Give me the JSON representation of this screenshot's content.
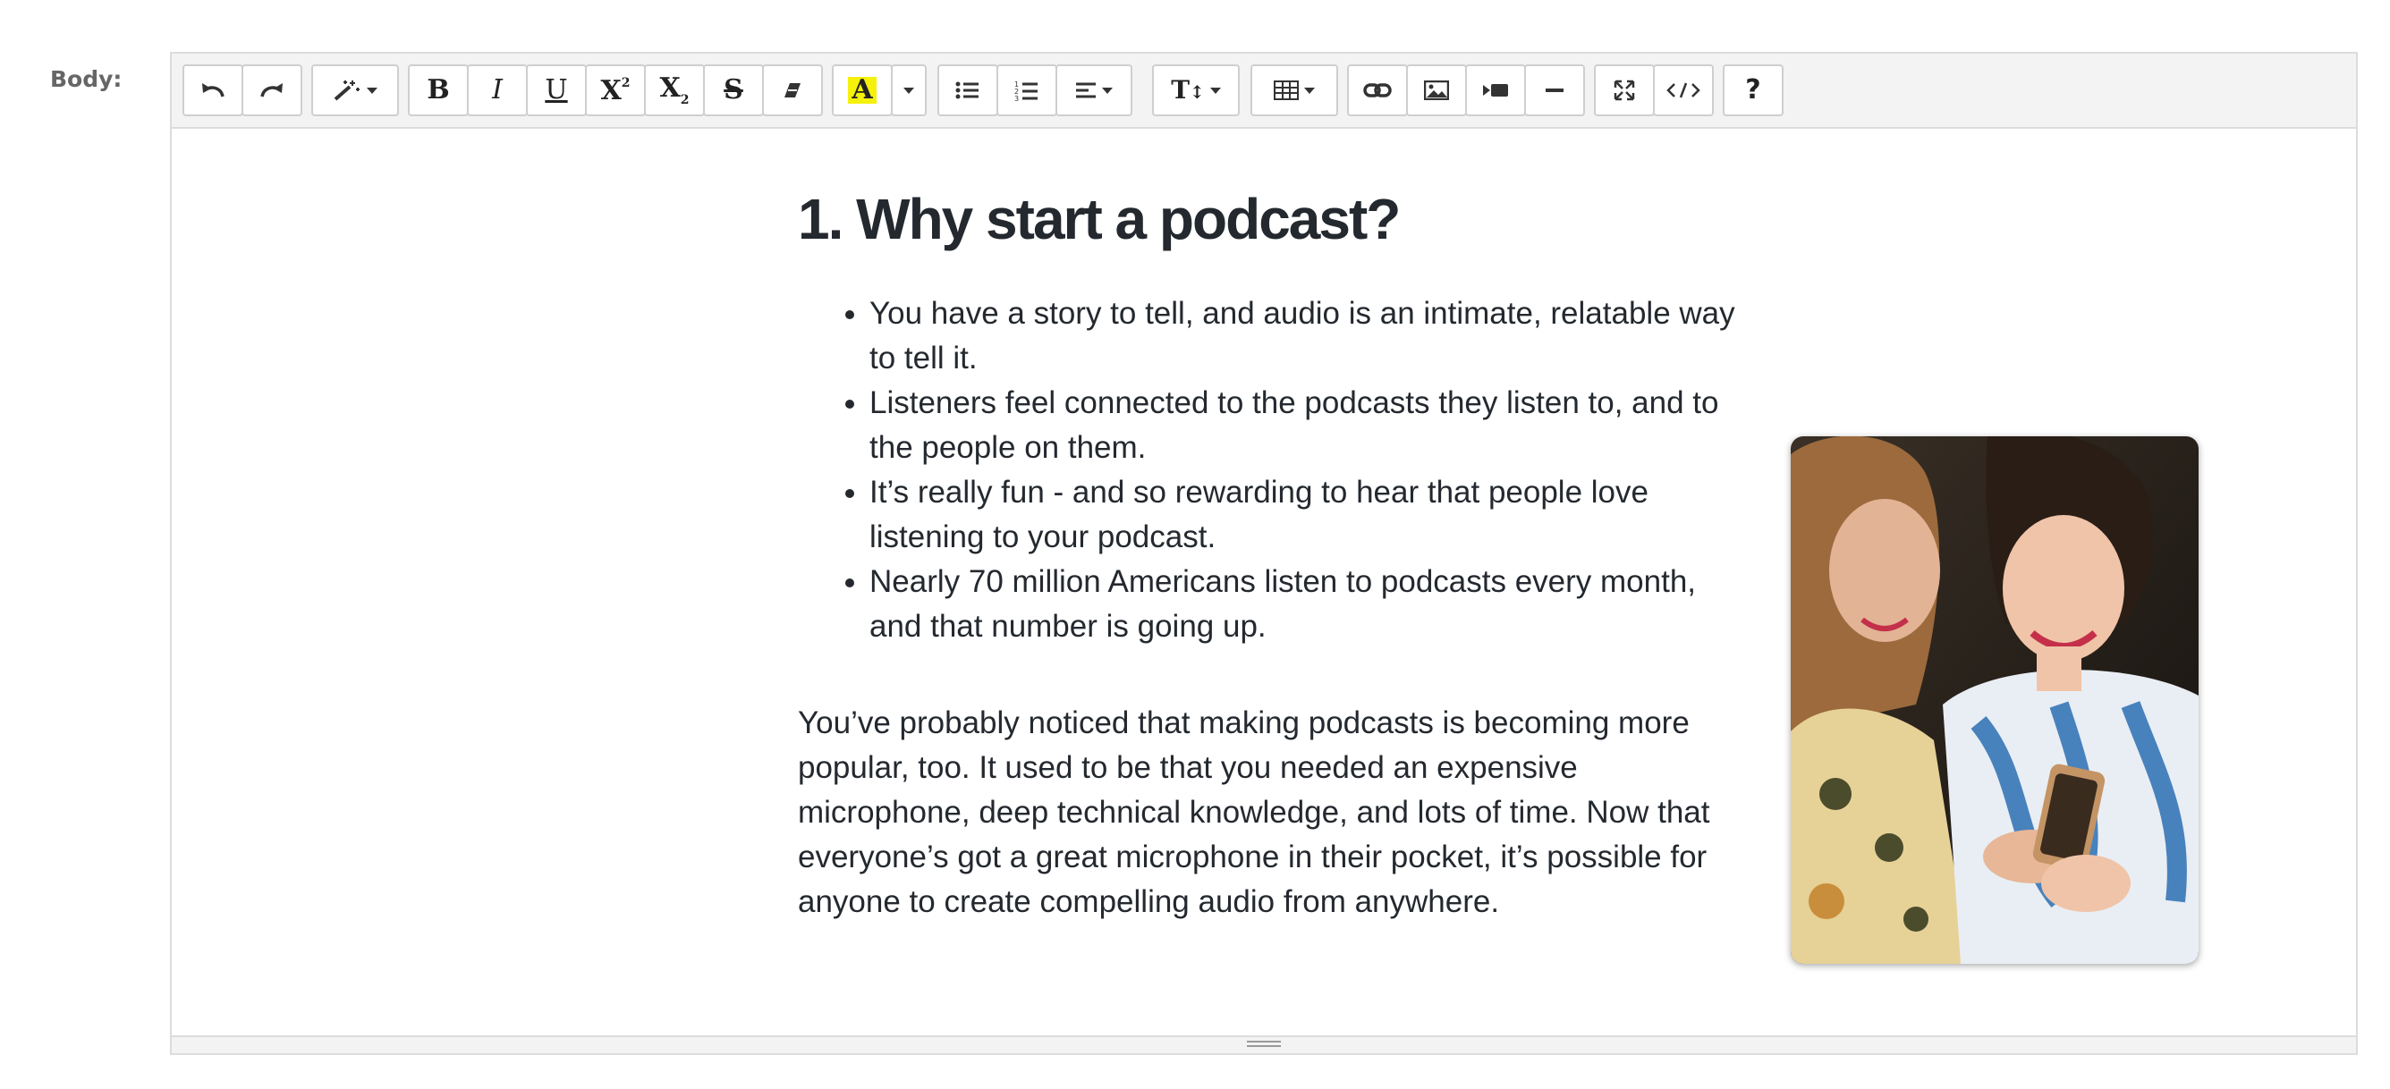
{
  "field": {
    "label": "Body:"
  },
  "toolbar": {
    "undo_icon": "undo-icon",
    "redo_icon": "redo-icon",
    "style_icon": "magic-wand-icon",
    "bold": "B",
    "italic": "I",
    "underline": "U",
    "superscript": "X",
    "subscript": "X",
    "strikethrough": "S",
    "highlight": "A",
    "highlight_color": "#f5f10a",
    "font_size": "T",
    "help": "?"
  },
  "article": {
    "heading": "1. Why start a podcast?",
    "points": [
      "You have a story to tell, and audio is an intimate, relatable way to tell it.",
      "Listeners feel connected to the podcasts they listen to, and to the people on them.",
      "It’s really fun - and so rewarding to hear that people love listening to your podcast.",
      "Nearly 70 million Americans listen to podcasts every month, and that number is going up."
    ],
    "paragraph": "You’ve probably noticed that making podcasts is becoming more popular, too. It used to be that you needed an expensive microphone, deep technical knowledge, and lots of time. Now that everyone’s got a great microphone in their pocket, it’s possible for anyone to create compelling audio from anywhere."
  }
}
